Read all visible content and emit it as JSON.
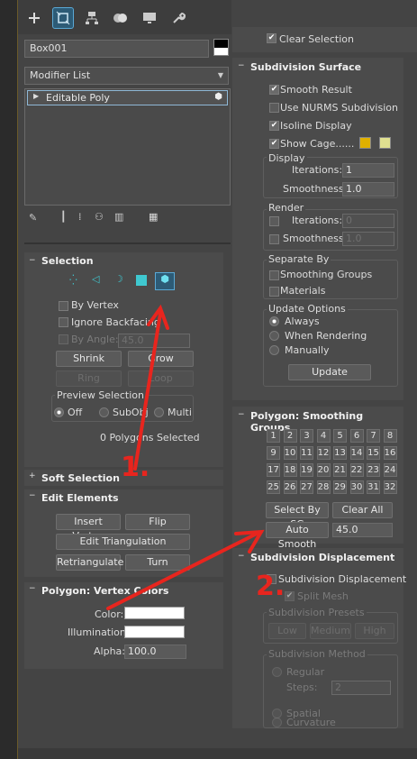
{
  "toolbar": {
    "tabs": [
      "create-tab",
      "modify-tab",
      "hierarchy-tab",
      "motion-tab",
      "display-tab",
      "utilities-tab"
    ]
  },
  "object_name": "Box001",
  "modifier_list": {
    "label": "Modifier List"
  },
  "stack": {
    "item": "Editable Poly"
  },
  "selection": {
    "title": "Selection",
    "by_vertex": "By Vertex",
    "ignore_backfacing": "Ignore Backfacing",
    "by_angle": "By Angle:",
    "by_angle_value": "45.0",
    "shrink": "Shrink",
    "grow": "Grow",
    "ring": "Ring",
    "loop": "Loop",
    "preview_title": "Preview Selection",
    "preview_off": "Off",
    "preview_subobj": "SubObj",
    "preview_multi": "Multi",
    "status": "0 Polygons Selected"
  },
  "soft_selection": {
    "title": "Soft Selection"
  },
  "edit_elements": {
    "title": "Edit Elements",
    "insert_vertex": "Insert Vertex",
    "flip": "Flip",
    "edit_triangulation": "Edit Triangulation",
    "retriangulate": "Retriangulate",
    "turn": "Turn"
  },
  "vertex_colors": {
    "title": "Polygon: Vertex Colors",
    "color": "Color:",
    "illumination": "Illumination:",
    "alpha": "Alpha:",
    "alpha_value": "100.0"
  },
  "right_top": {
    "clear_selection": "Clear Selection"
  },
  "subdivision_surface": {
    "title": "Subdivision Surface",
    "smooth_result": "Smooth Result",
    "use_nurms": "Use NURMS Subdivision",
    "isoline_display": "Isoline Display",
    "show_cage": "Show Cage......",
    "cage_color1": "#e0b000",
    "cage_color2": "#e0e090",
    "display": "Display",
    "iterations": "Iterations:",
    "iterations_value": "1",
    "smoothness": "Smoothness:",
    "smoothness_value": "1.0",
    "render": "Render",
    "render_iterations": "Iterations:",
    "render_iterations_value": "0",
    "render_smoothness": "Smoothness:",
    "render_smoothness_value": "1.0",
    "separate_by": "Separate By",
    "smoothing_groups": "Smoothing Groups",
    "materials": "Materials",
    "update_options": "Update Options",
    "always": "Always",
    "when_rendering": "When Rendering",
    "manually": "Manually",
    "update": "Update"
  },
  "smoothing_groups": {
    "title": "Polygon: Smoothing Groups",
    "numbers": [
      "1",
      "2",
      "3",
      "4",
      "5",
      "6",
      "7",
      "8",
      "9",
      "10",
      "11",
      "12",
      "13",
      "14",
      "15",
      "16",
      "17",
      "18",
      "19",
      "20",
      "21",
      "22",
      "23",
      "24",
      "25",
      "26",
      "27",
      "28",
      "29",
      "30",
      "31",
      "32"
    ],
    "select_by_sg": "Select By SG",
    "clear_all": "Clear All",
    "auto_smooth": "Auto Smooth",
    "auto_smooth_value": "45.0"
  },
  "subdivision_displacement": {
    "title": "Subdivision Displacement",
    "subdiv_disp": "Subdivision Displacement",
    "split_mesh": "Split Mesh",
    "presets": "Subdivision Presets",
    "low": "Low",
    "medium": "Medium",
    "high": "High",
    "method": "Subdivision Method",
    "regular": "Regular",
    "steps": "Steps:",
    "steps_value": "2",
    "spatial": "Spatial",
    "curvature": "Curvature"
  },
  "annotations": {
    "one": "1.",
    "two": "2."
  },
  "colors": {
    "accent": "#2d5b76",
    "annotation_red": "#e8251e"
  }
}
